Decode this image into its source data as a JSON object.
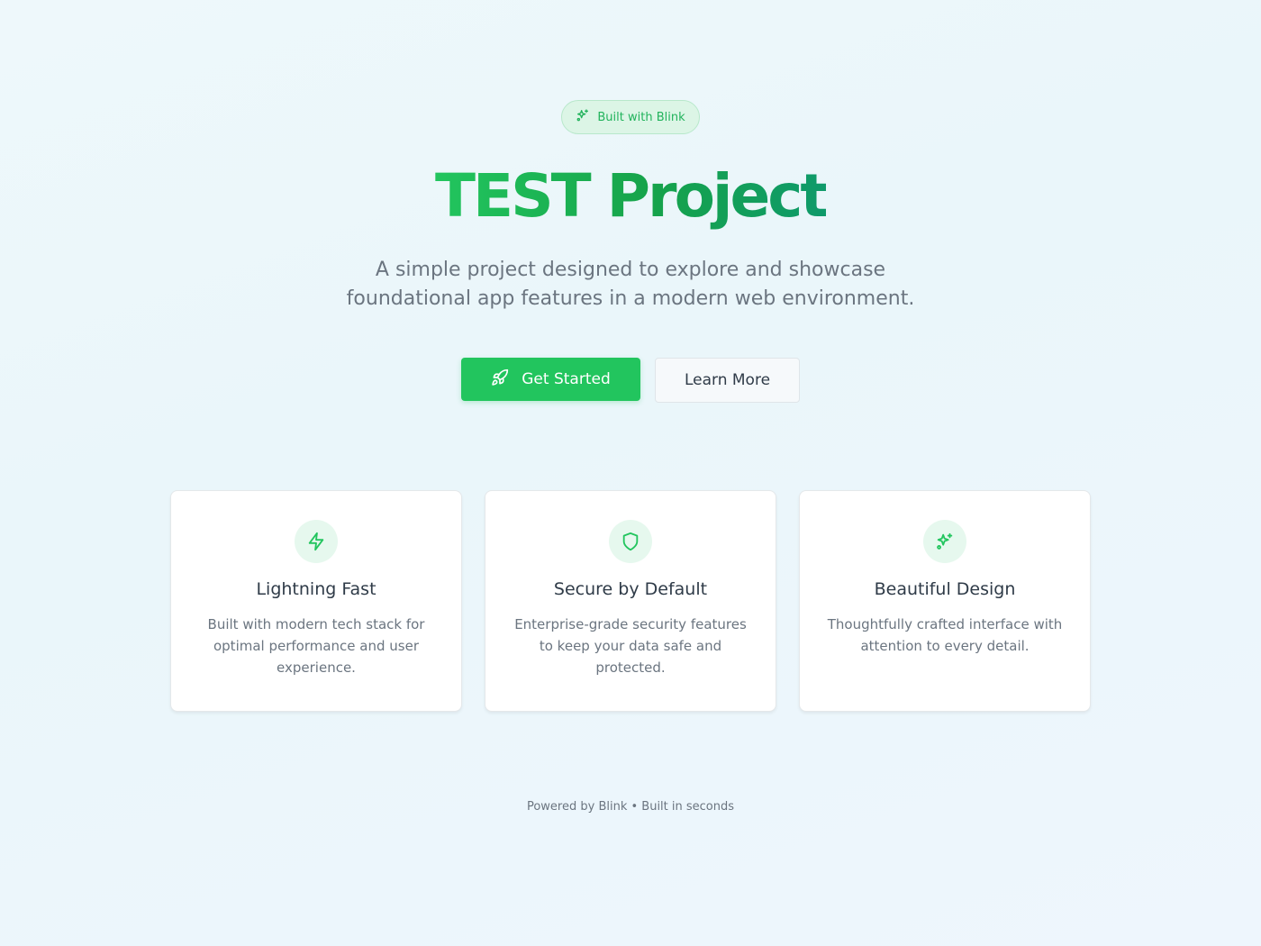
{
  "badge": {
    "icon": "sparkles-icon",
    "label": "Built with Blink"
  },
  "hero": {
    "title": "TEST Project",
    "subtitle": "A simple project designed to explore and showcase foundational app features in a modern web environment."
  },
  "actions": {
    "primary": {
      "icon": "rocket-icon",
      "label": "Get Started"
    },
    "secondary": {
      "label": "Learn More"
    }
  },
  "features": [
    {
      "icon": "lightning-icon",
      "title": "Lightning Fast",
      "description": "Built with modern tech stack for optimal performance and user experience."
    },
    {
      "icon": "shield-icon",
      "title": "Secure by Default",
      "description": "Enterprise-grade security features to keep your data safe and protected."
    },
    {
      "icon": "sparkles-icon",
      "title": "Beautiful Design",
      "description": "Thoughtfully crafted interface with attention to every detail."
    }
  ],
  "footer": {
    "text": "Powered by Blink • Built in seconds"
  },
  "colors": {
    "accent": "#22c55e",
    "accent_dark": "#16a34a",
    "background": "#eaf6fa",
    "text_muted": "#6b7580"
  }
}
